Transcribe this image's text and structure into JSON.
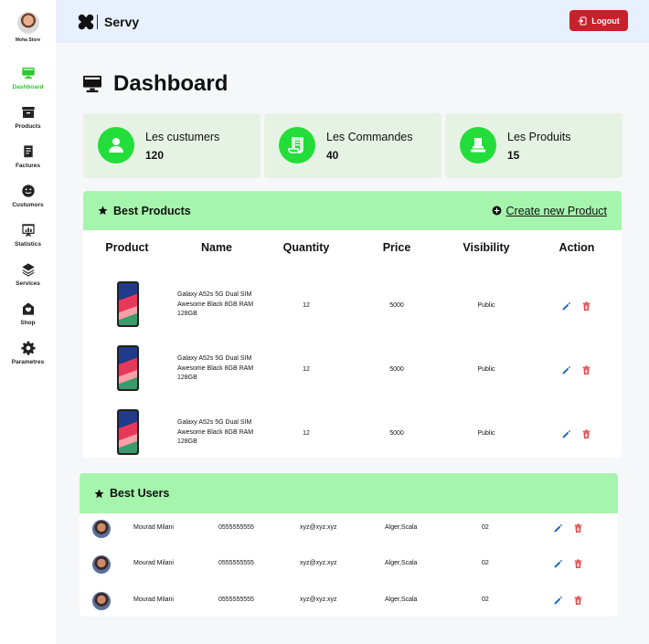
{
  "profile": {
    "name": "Moha Store"
  },
  "nav": [
    {
      "label": "Dashboard",
      "icon": "monitor-icon"
    },
    {
      "label": "Products",
      "icon": "archive-box-icon"
    },
    {
      "label": "Factures",
      "icon": "receipt-icon"
    },
    {
      "label": "Custumors",
      "icon": "smiley-face-icon"
    },
    {
      "label": "Statistics",
      "icon": "chart-board-icon"
    },
    {
      "label": "Services",
      "icon": "layers-icon"
    },
    {
      "label": "Shop",
      "icon": "shop-icon"
    },
    {
      "label": "Parametres",
      "icon": "gear-icon"
    }
  ],
  "topbar": {
    "brand": "Servy",
    "logout": "Logout"
  },
  "page": {
    "title": "Dashboard"
  },
  "stats": [
    {
      "label": "Les custumers",
      "value": "120",
      "icon": "user-icon"
    },
    {
      "label": "Les Commandes",
      "value": "40",
      "icon": "scroll-icon"
    },
    {
      "label": "Les Produits",
      "value": "15",
      "icon": "product-icon"
    }
  ],
  "best_products": {
    "title": "Best Products",
    "create_label": "Create new Product",
    "columns": [
      "Product",
      "Name",
      "Quantity",
      "Price",
      "Visibility",
      "Action"
    ],
    "rows": [
      {
        "name": "Galaxy A52s 5G Dual SIM Awesome Black 8GB RAM 128GB",
        "quantity": "12",
        "price": "5000",
        "visibility": "Public"
      },
      {
        "name": "Galaxy A52s 5G Dual SIM Awesome Black 8GB RAM 128GB",
        "quantity": "12",
        "price": "5000",
        "visibility": "Public"
      },
      {
        "name": "Galaxy A52s 5G Dual SIM Awesome Black 8GB RAM 128GB",
        "quantity": "12",
        "price": "5000",
        "visibility": "Public"
      }
    ]
  },
  "best_users": {
    "title": "Best Users",
    "rows": [
      {
        "name": "Mourad Milani",
        "phone": "0555555555",
        "email": "xyz@xyz.xyz",
        "location": "Alger,Scala",
        "count": "02"
      },
      {
        "name": "Mourad Milani",
        "phone": "0555555555",
        "email": "xyz@xyz.xyz",
        "location": "Alger,Scala",
        "count": "02"
      },
      {
        "name": "Mourad Milani",
        "phone": "0555555555",
        "email": "xyz@xyz.xyz",
        "location": "Alger,Scala",
        "count": "02"
      }
    ]
  },
  "colors": {
    "accent_green": "#22dd3a",
    "active_nav": "#2bc82b",
    "panel_head": "#a6f5ad",
    "stat_bg": "#e6f3e4",
    "logout_red": "#c9202b",
    "edit_blue": "#1565c0",
    "delete_red": "#d32f2f"
  }
}
